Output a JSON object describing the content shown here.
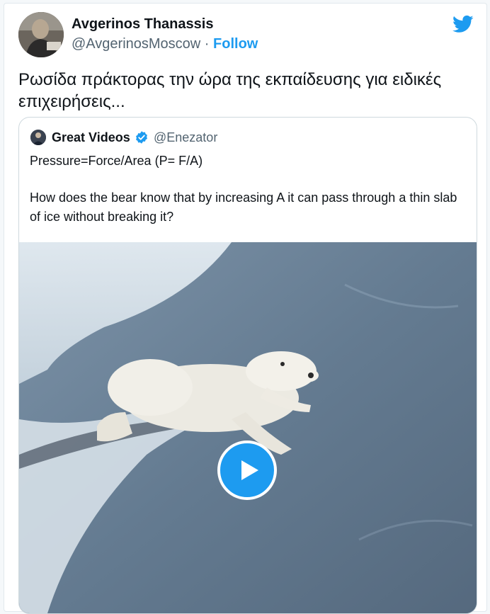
{
  "author": {
    "name": "Avgerinos Thanassis",
    "handle": "@AvgerinosMoscow",
    "separator": " · ",
    "follow_label": "Follow"
  },
  "tweet": {
    "text": "Ρωσίδα πράκτορας την ώρα της εκπαίδευσης για ειδικές επιχειρήσεις..."
  },
  "quoted_tweet": {
    "name": "Great Videos",
    "handle": "@Enezator",
    "line1": "Pressure=Force/Area (P= F/A)",
    "body": "How does the bear know that by increasing A it can pass through a thin slab of ice without breaking it?"
  },
  "icons": {
    "brand": "twitter-bird-icon",
    "verified": "verified-badge-icon",
    "play": "play-icon"
  },
  "colors": {
    "accent": "#1d9bf0",
    "text": "#0f1419",
    "secondary": "#536471",
    "border": "#cfd9de"
  }
}
